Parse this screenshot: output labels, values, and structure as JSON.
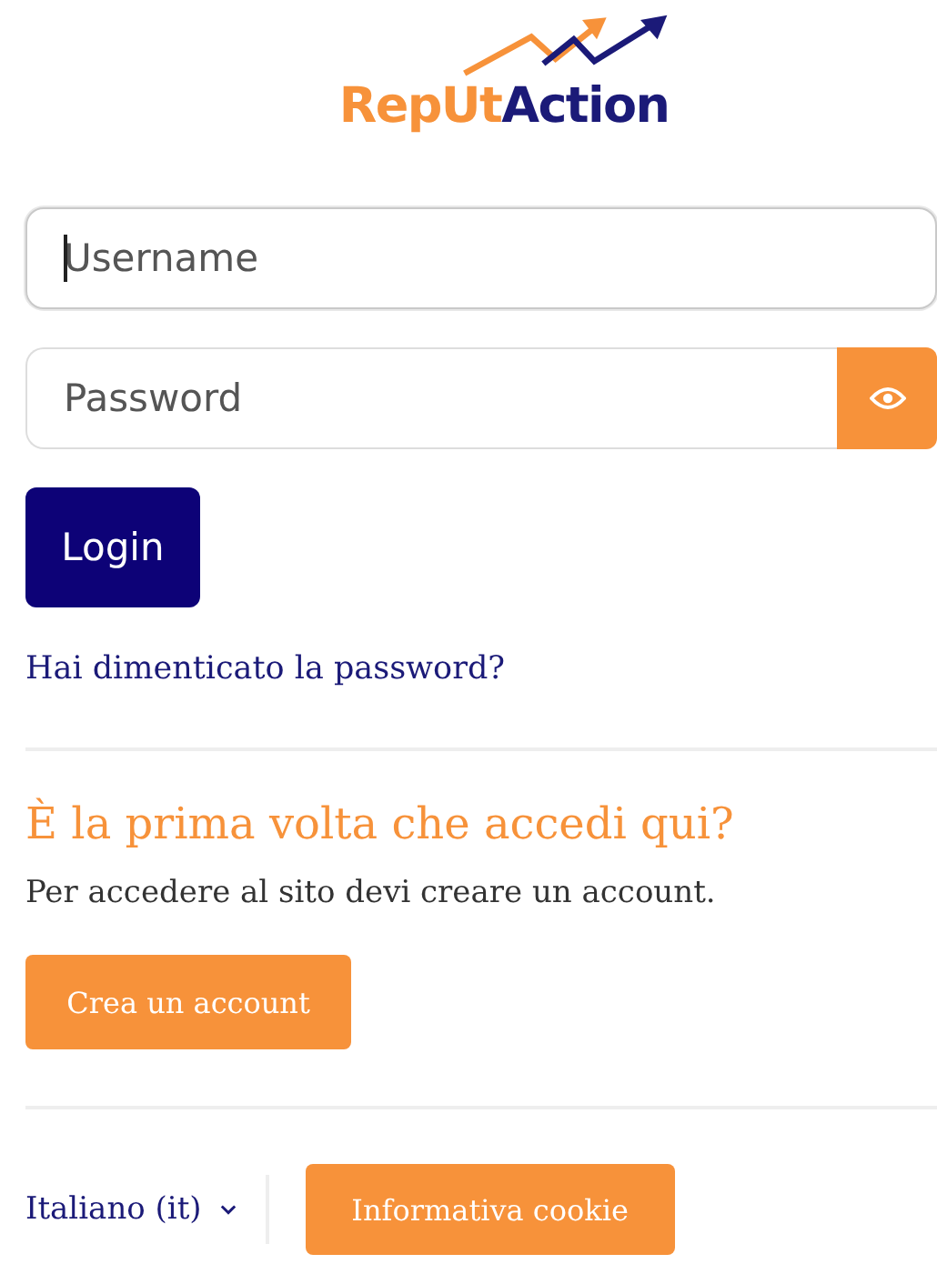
{
  "logo": {
    "parts": [
      {
        "text": "RepUt",
        "color": "#f7923a"
      },
      {
        "text": "Action",
        "color": "#1b1a78"
      }
    ]
  },
  "username": {
    "placeholder": "Username",
    "focused": true
  },
  "password": {
    "placeholder": "Password"
  },
  "login_button": "Login",
  "forgot_link": "Hai dimenticato la password?",
  "signup": {
    "heading": "È la prima volta che accedi qui?",
    "text": "Per accedere al sito devi creare un account.",
    "button": "Crea un account"
  },
  "footer": {
    "language": "Italiano (it)",
    "cookie_button": "Informativa cookie"
  }
}
